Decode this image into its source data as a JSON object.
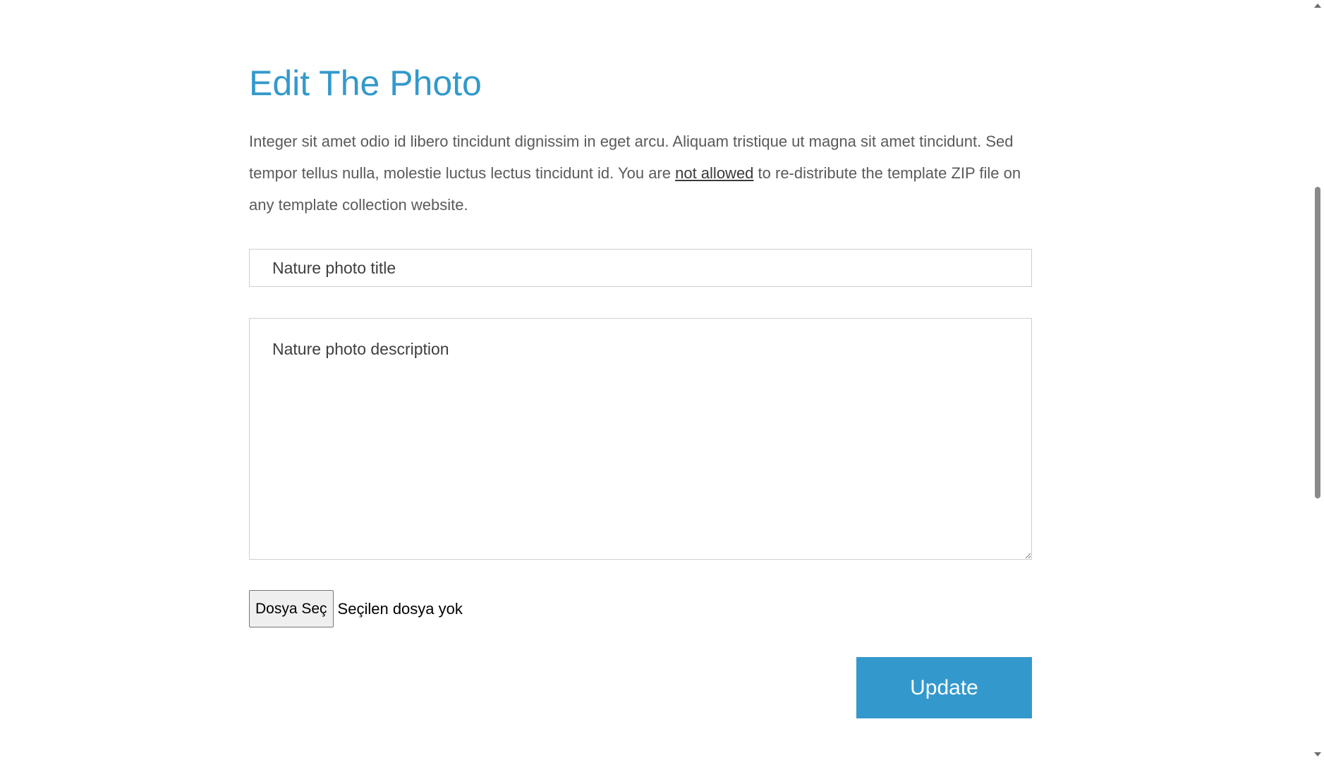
{
  "page": {
    "title": "Edit The Photo",
    "intro_before": "Integer sit amet odio id libero tincidunt dignissim in eget arcu. Aliquam tristique ut magna sit amet tincidunt. Sed tempor tellus nulla, molestie luctus lectus tincidunt id. You are ",
    "intro_link": "not allowed",
    "intro_after": " to re-distribute the template ZIP file on any template collection website."
  },
  "form": {
    "title_placeholder": "Nature photo title",
    "title_value": "",
    "description_placeholder": "Nature photo description",
    "description_value": "",
    "file_button_label": "Dosya Seç",
    "file_status": "Seçilen dosya yok",
    "submit_label": "Update"
  },
  "colors": {
    "accent": "#3399cc",
    "body_text": "#5a5a5a",
    "border": "#cfcfcf"
  },
  "icons": {
    "scroll_up": "triangle-up",
    "scroll_down": "triangle-down"
  }
}
